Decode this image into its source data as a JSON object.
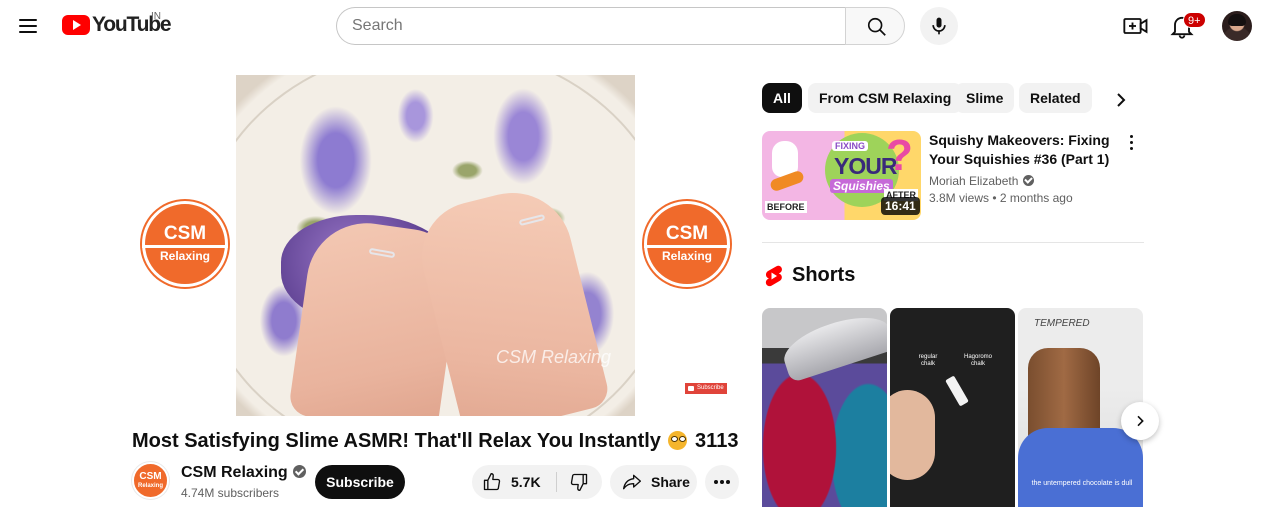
{
  "header": {
    "logo_text": "YouTube",
    "country_code": "IN",
    "search_placeholder": "Search",
    "notification_count": "9+"
  },
  "player": {
    "watermark": "CSM Relaxing",
    "badge_line1": "CSM",
    "badge_line2": "Relaxing",
    "endscreen_subscribe": "Subscribe"
  },
  "video": {
    "title": "Most Satisfying Slime ASMR! That'll Relax You Instantly",
    "title_suffix": "3113"
  },
  "owner": {
    "avatar_line1": "CSM",
    "avatar_line2": "Relaxing",
    "channel_name": "CSM Relaxing",
    "subscribers": "4.74M subscribers",
    "subscribe_label": "Subscribe"
  },
  "actions": {
    "like_count": "5.7K",
    "share_label": "Share"
  },
  "chips": [
    {
      "label": "All",
      "active": true
    },
    {
      "label": "From CSM Relaxing",
      "active": false
    },
    {
      "label": "Slime",
      "active": false
    },
    {
      "label": "Related",
      "active": false
    }
  ],
  "recommendation": {
    "title": "Squishy Makeovers: Fixing Your Squishies #36 (Part 1)",
    "channel": "Moriah Elizabeth",
    "views": "3.8M views",
    "age": "2 months ago",
    "duration": "16:41",
    "thumb_text_fixing": "FIXING",
    "thumb_text_your": "YOUR",
    "thumb_text_squishies": "Squishies",
    "thumb_text_before": "BEFORE",
    "thumb_text_after": "AFTER"
  },
  "shorts": {
    "section_title": "Shorts",
    "items": [
      {
        "caption": ""
      },
      {
        "label_left": "regular chalk",
        "label_right": "Hagoromo chalk"
      },
      {
        "top_text": "TEMPERED",
        "caption": "the untempered chocolate is dull"
      }
    ]
  },
  "colors": {
    "brand_red": "#ff0000",
    "text_primary": "#0f0f0f",
    "text_secondary": "#606060",
    "chip_bg": "#f2f2f2",
    "channel_orange": "#f06a2b"
  }
}
